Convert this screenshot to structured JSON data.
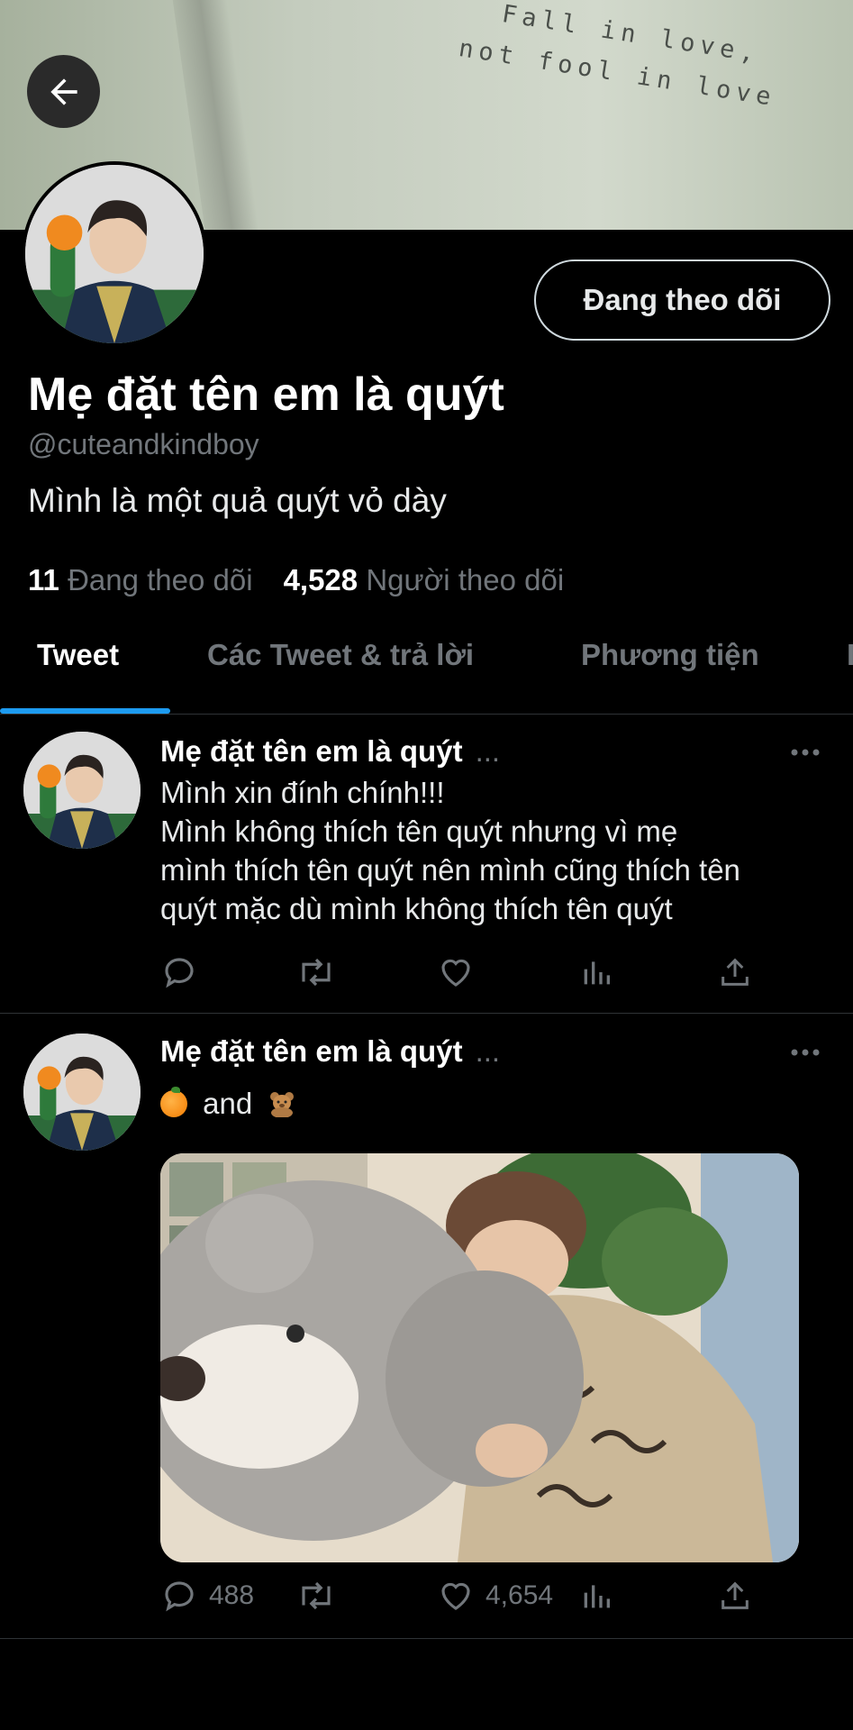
{
  "banner": {
    "line1": "Fall in love,",
    "line2": "not fool in love"
  },
  "profile": {
    "name": "Mẹ đặt tên em là quýt",
    "handle": "@cuteandkindboy",
    "bio": "Mình là một quả quýt vỏ dày",
    "follow_button": "Đang theo dõi",
    "following_count": "11",
    "following_label": "Đang theo dõi",
    "followers_count": "4,528",
    "followers_label": "Người theo dõi"
  },
  "tabs": [
    {
      "label": "Tweet",
      "active": true
    },
    {
      "label": "Các Tweet & trả lời",
      "active": false
    },
    {
      "label": "Phương tiện",
      "active": false
    }
  ],
  "tweets": [
    {
      "author": "Mẹ đặt tên em là quýt",
      "ellipsis": "...",
      "lines": [
        "Mình xin đính chính!!!",
        "Mình không thích tên quýt nhưng vì mẹ",
        "mình thích tên quýt nên mình cũng thích tên",
        "quýt mặc dù mình không thích tên quýt"
      ]
    },
    {
      "author": "Mẹ đặt tên em là quýt",
      "ellipsis": "...",
      "text": "and",
      "reply_count": "488",
      "like_count": "4,654"
    }
  ],
  "icons": [
    "back-arrow-icon",
    "more-icon",
    "reply-icon",
    "retweet-icon",
    "like-icon",
    "views-icon",
    "share-icon",
    "orange-emoji-icon",
    "teddy-bear-emoji-icon"
  ],
  "colors": {
    "accent": "#1d9bf0",
    "muted": "#71767b",
    "background": "#000000"
  }
}
